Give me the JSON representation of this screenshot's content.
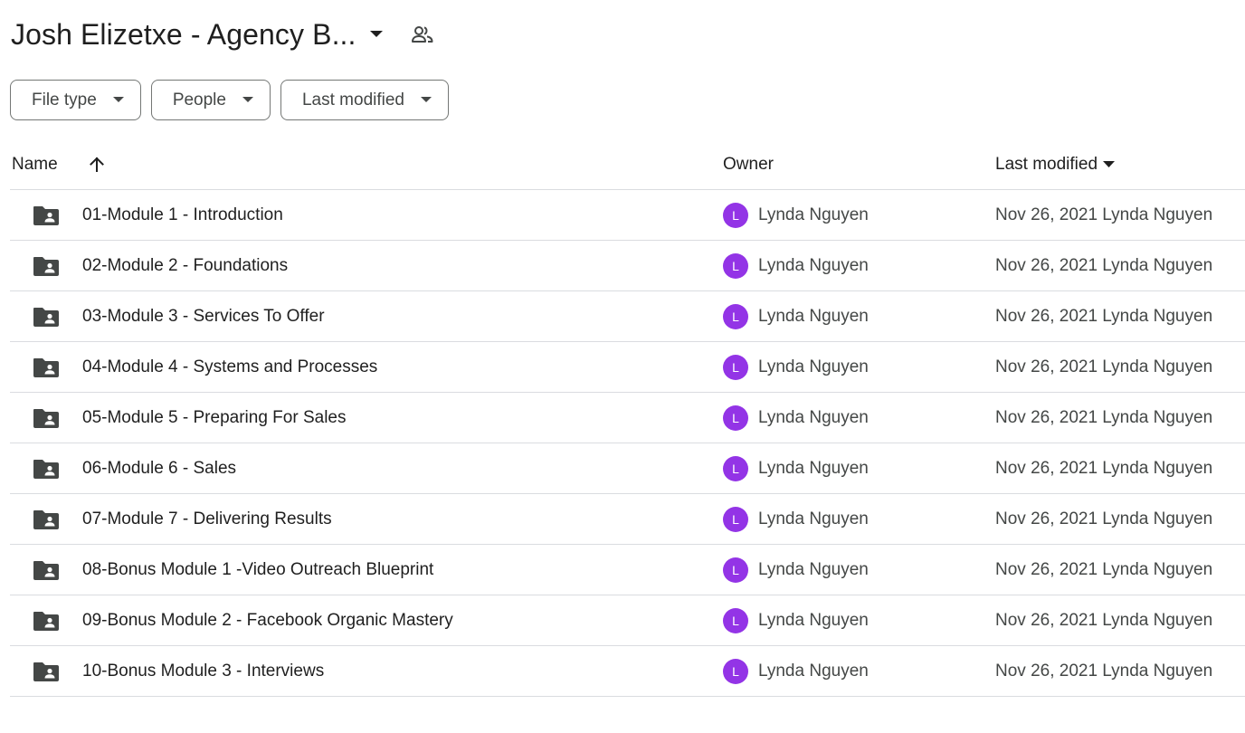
{
  "header": {
    "title": "Josh Elizetxe - Agency B...",
    "caret_icon": "arrow-drop-down-icon",
    "shared_icon": "people-icon"
  },
  "filters": [
    {
      "label": "File type"
    },
    {
      "label": "People"
    },
    {
      "label": "Last modified"
    }
  ],
  "columns": {
    "name": "Name",
    "owner": "Owner",
    "modified": "Last modified"
  },
  "rows": [
    {
      "name": "01-Module 1 - Introduction",
      "avatar": "L",
      "owner": "Lynda Nguyen",
      "modified": "Nov 26, 2021 Lynda Nguyen"
    },
    {
      "name": "02-Module 2 - Foundations",
      "avatar": "L",
      "owner": "Lynda Nguyen",
      "modified": "Nov 26, 2021 Lynda Nguyen"
    },
    {
      "name": "03-Module 3 - Services To Offer",
      "avatar": "L",
      "owner": "Lynda Nguyen",
      "modified": "Nov 26, 2021 Lynda Nguyen"
    },
    {
      "name": "04-Module 4 - Systems and Processes",
      "avatar": "L",
      "owner": "Lynda Nguyen",
      "modified": "Nov 26, 2021 Lynda Nguyen"
    },
    {
      "name": "05-Module 5 - Preparing For Sales",
      "avatar": "L",
      "owner": "Lynda Nguyen",
      "modified": "Nov 26, 2021 Lynda Nguyen"
    },
    {
      "name": "06-Module 6 - Sales",
      "avatar": "L",
      "owner": "Lynda Nguyen",
      "modified": "Nov 26, 2021 Lynda Nguyen"
    },
    {
      "name": "07-Module 7 - Delivering Results",
      "avatar": "L",
      "owner": "Lynda Nguyen",
      "modified": "Nov 26, 2021 Lynda Nguyen"
    },
    {
      "name": "08-Bonus Module 1 -Video Outreach Blueprint",
      "avatar": "L",
      "owner": "Lynda Nguyen",
      "modified": "Nov 26, 2021 Lynda Nguyen"
    },
    {
      "name": "09-Bonus Module 2 - Facebook Organic Mastery",
      "avatar": "L",
      "owner": "Lynda Nguyen",
      "modified": "Nov 26, 2021 Lynda Nguyen"
    },
    {
      "name": "10-Bonus Module 3 - Interviews",
      "avatar": "L",
      "owner": "Lynda Nguyen",
      "modified": "Nov 26, 2021 Lynda Nguyen"
    }
  ],
  "colors": {
    "avatar": "#9334e6",
    "folder": "#444746",
    "divider": "#dadce0",
    "chip_border": "#747775"
  },
  "icons": {
    "folder": "shared-folder-icon",
    "sort_name": "arrow-upward-icon",
    "sort_modified": "arrow-drop-down-icon"
  }
}
